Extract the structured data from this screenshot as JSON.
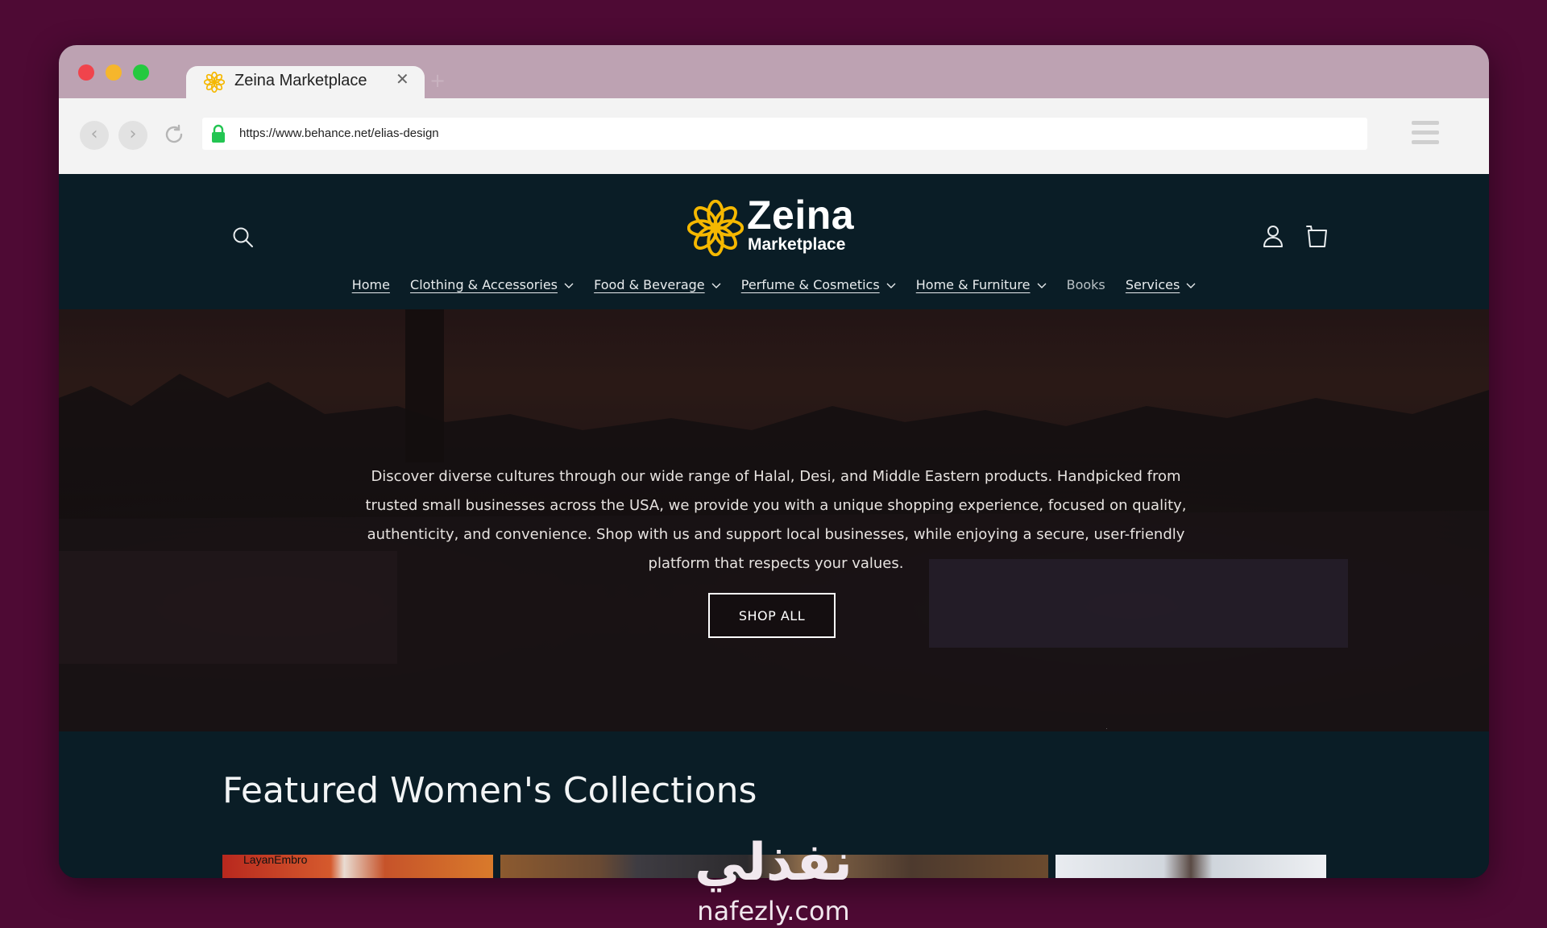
{
  "browser": {
    "tab_title": "Zeina Marketplace",
    "tab_close": "✕",
    "new_tab": "+",
    "url": "https://www.behance.net/elias-design",
    "back_symbol": "‹",
    "forward_symbol": "›",
    "traffic_lights": [
      "#f0444c",
      "#f6b62c",
      "#24c93f"
    ]
  },
  "site": {
    "logo_name": "Zeina",
    "logo_sub": "Marketplace",
    "brand_color": "#f5b800",
    "nav": [
      {
        "label": "Home",
        "dropdown": false
      },
      {
        "label": "Clothing & Accessories",
        "dropdown": true
      },
      {
        "label": "Food & Beverage",
        "dropdown": true
      },
      {
        "label": "Perfume & Cosmetics",
        "dropdown": true
      },
      {
        "label": "Home & Furniture",
        "dropdown": true
      },
      {
        "label": "Books",
        "dropdown": false
      },
      {
        "label": "Services",
        "dropdown": true
      }
    ],
    "icons": {
      "search": "search-icon",
      "account": "account-icon",
      "cart": "cart-icon"
    }
  },
  "hero": {
    "description": "Discover diverse cultures through our wide range of Halal, Desi, and Middle Eastern products. Handpicked from trusted small businesses across the USA, we provide you with a unique shopping experience, focused on quality, authenticity, and convenience. Shop with us and support local businesses, while enjoying a secure, user-friendly platform that respects your values.",
    "cta_label": "SHOP ALL"
  },
  "featured": {
    "title": "Featured Women's Collections",
    "cards": [
      {
        "label": "LayanEmbro"
      },
      {
        "label": ""
      },
      {
        "label": ""
      }
    ]
  },
  "watermark": {
    "arabic": "نفذلي",
    "latin": "nafezly.com"
  }
}
